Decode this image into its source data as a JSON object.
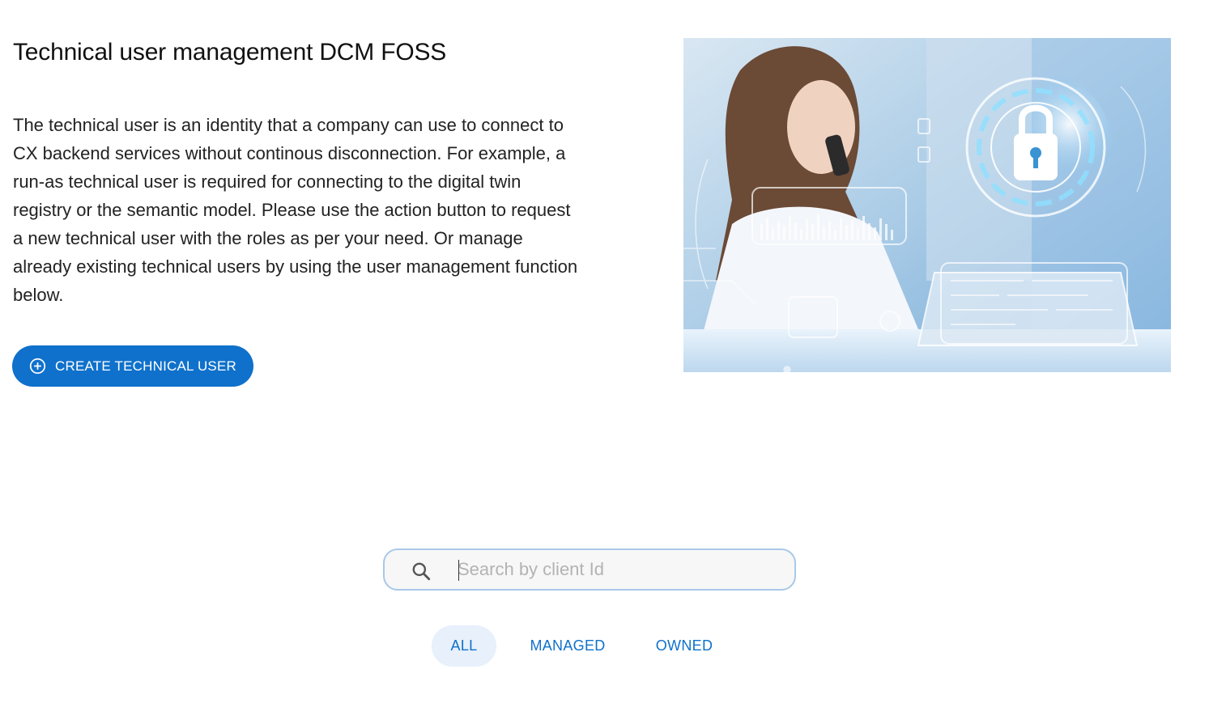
{
  "header": {
    "title": "Technical user management DCM FOSS"
  },
  "intro": {
    "description": "The technical user is an identity that a company can use to connect to CX backend services without continous disconnection. For example, a run-as technical user is required for connecting to the digital twin registry or the semantic model. Please use the action button to request a new technical user with the roles as per your need. Or manage already existing technical users by using the user management function below."
  },
  "actions": {
    "create_label": "CREATE TECHNICAL USER",
    "create_icon": "plus-circle-icon"
  },
  "search": {
    "placeholder": "Search by client Id",
    "value": "",
    "icon": "search-icon"
  },
  "filters": {
    "selected": "ALL",
    "items": [
      {
        "label": "ALL"
      },
      {
        "label": "MANAGED"
      },
      {
        "label": "OWNED"
      }
    ]
  },
  "colors": {
    "primary": "#0f71cb",
    "active_filter_bg": "#e7f0fb",
    "search_border": "#a9c8e8"
  }
}
